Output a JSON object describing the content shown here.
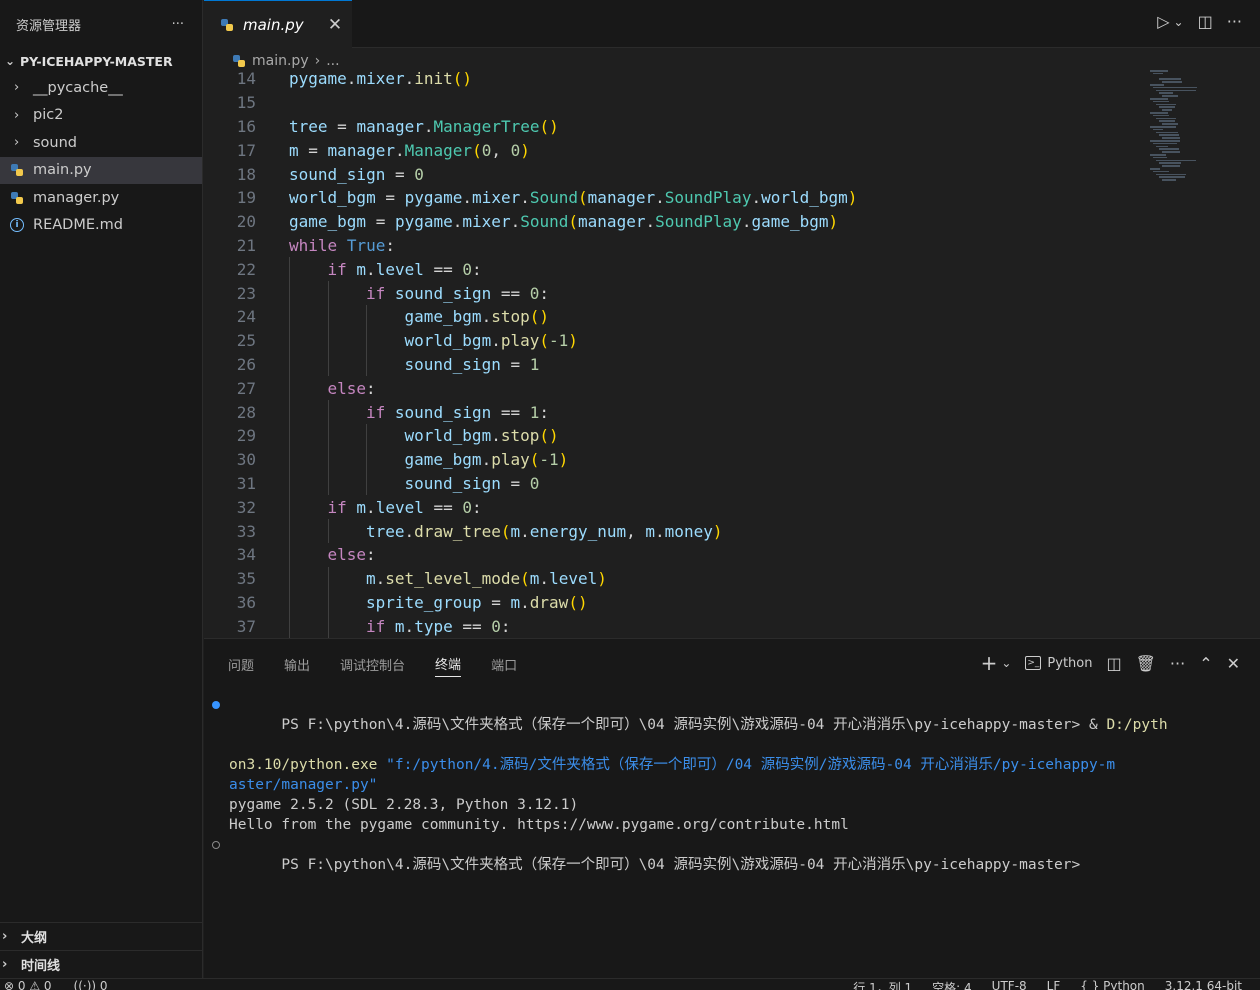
{
  "sidebar": {
    "title": "资源管理器",
    "more": "···",
    "folder": "PY-ICEHAPPY-MASTER",
    "folders": [
      "__pycache__",
      "pic2",
      "sound"
    ],
    "files": [
      "main.py",
      "manager.py",
      "README.md"
    ],
    "outline": "大纲",
    "timeline": "时间线"
  },
  "tab": {
    "label": "main.py",
    "close": "✕"
  },
  "breadcrumb": {
    "file": "main.py",
    "rest": "..."
  },
  "code_lines": [
    {
      "n": "14",
      "html": "<span class=\"v\">pygame</span>.<span class=\"v\">mixer</span>.<span class=\"fn\">init</span><span class=\"p1\">()</span>",
      "indent": 0
    },
    {
      "n": "15",
      "html": "",
      "indent": 0
    },
    {
      "n": "16",
      "html": "<span class=\"v\">tree</span> = <span class=\"v\">manager</span>.<span class=\"cls\">ManagerTree</span><span class=\"p1\">()</span>",
      "indent": 0
    },
    {
      "n": "17",
      "html": "<span class=\"v\">m</span> = <span class=\"v\">manager</span>.<span class=\"cls\">Manager</span><span class=\"p1\">(</span><span class=\"num\">0</span>, <span class=\"num\">0</span><span class=\"p1\">)</span>",
      "indent": 0
    },
    {
      "n": "18",
      "html": "<span class=\"v\">sound_sign</span> = <span class=\"num\">0</span>",
      "indent": 0
    },
    {
      "n": "19",
      "html": "<span class=\"v\">world_bgm</span> = <span class=\"v\">pygame</span>.<span class=\"v\">mixer</span>.<span class=\"cls\">Sound</span><span class=\"p1\">(</span><span class=\"v\">manager</span>.<span class=\"cls\">SoundPlay</span>.<span class=\"v\">world_bgm</span><span class=\"p1\">)</span>",
      "indent": 0
    },
    {
      "n": "20",
      "html": "<span class=\"v\">game_bgm</span> = <span class=\"v\">pygame</span>.<span class=\"v\">mixer</span>.<span class=\"cls\">Sound</span><span class=\"p1\">(</span><span class=\"v\">manager</span>.<span class=\"cls\">SoundPlay</span>.<span class=\"v\">game_bgm</span><span class=\"p1\">)</span>",
      "indent": 0
    },
    {
      "n": "21",
      "html": "<span class=\"kw\">while</span> <span class=\"bl\">True</span>:",
      "indent": 0
    },
    {
      "n": "22",
      "html": "<span class=\"kw\">if</span> <span class=\"v\">m</span>.<span class=\"v\">level</span> == <span class=\"num\">0</span>:",
      "indent": 1
    },
    {
      "n": "23",
      "html": "<span class=\"kw\">if</span> <span class=\"v\">sound_sign</span> == <span class=\"num\">0</span>:",
      "indent": 2
    },
    {
      "n": "24",
      "html": "<span class=\"v\">game_bgm</span>.<span class=\"fn\">stop</span><span class=\"p1\">()</span>",
      "indent": 3
    },
    {
      "n": "25",
      "html": "<span class=\"v\">world_bgm</span>.<span class=\"fn\">play</span><span class=\"p1\">(</span><span class=\"num\">-1</span><span class=\"p1\">)</span>",
      "indent": 3
    },
    {
      "n": "26",
      "html": "<span class=\"v\">sound_sign</span> = <span class=\"num\">1</span>",
      "indent": 3
    },
    {
      "n": "27",
      "html": "<span class=\"kw\">else</span>:",
      "indent": 1
    },
    {
      "n": "28",
      "html": "<span class=\"kw\">if</span> <span class=\"v\">sound_sign</span> == <span class=\"num\">1</span>:",
      "indent": 2
    },
    {
      "n": "29",
      "html": "<span class=\"v\">world_bgm</span>.<span class=\"fn\">stop</span><span class=\"p1\">()</span>",
      "indent": 3
    },
    {
      "n": "30",
      "html": "<span class=\"v\">game_bgm</span>.<span class=\"fn\">play</span><span class=\"p1\">(</span><span class=\"num\">-1</span><span class=\"p1\">)</span>",
      "indent": 3
    },
    {
      "n": "31",
      "html": "<span class=\"v\">sound_sign</span> = <span class=\"num\">0</span>",
      "indent": 3
    },
    {
      "n": "32",
      "html": "<span class=\"kw\">if</span> <span class=\"v\">m</span>.<span class=\"v\">level</span> == <span class=\"num\">0</span>:",
      "indent": 1
    },
    {
      "n": "33",
      "html": "<span class=\"v\">tree</span>.<span class=\"fn\">draw_tree</span><span class=\"p1\">(</span><span class=\"v\">m</span>.<span class=\"v\">energy_num</span>, <span class=\"v\">m</span>.<span class=\"v\">money</span><span class=\"p1\">)</span>",
      "indent": 2
    },
    {
      "n": "34",
      "html": "<span class=\"kw\">else</span>:",
      "indent": 1
    },
    {
      "n": "35",
      "html": "<span class=\"v\">m</span>.<span class=\"fn\">set_level_mode</span><span class=\"p1\">(</span><span class=\"v\">m</span>.<span class=\"v\">level</span><span class=\"p1\">)</span>",
      "indent": 2
    },
    {
      "n": "36",
      "html": "<span class=\"v\">sprite_group</span> = <span class=\"v\">m</span>.<span class=\"fn\">draw</span><span class=\"p1\">()</span>",
      "indent": 2
    },
    {
      "n": "37",
      "html": "<span class=\"kw\">if</span> <span class=\"v\">m</span>.<span class=\"v\">type</span> == <span class=\"num\">0</span>:",
      "indent": 2
    }
  ],
  "panel": {
    "tabs": [
      "问题",
      "输出",
      "调试控制台",
      "终端",
      "端口"
    ],
    "active_tab": "终端",
    "shell": "Python"
  },
  "terminal": {
    "line1_prompt": "PS F:\\python\\4.源码\\文件夹格式（保存一个即可）\\04 源码实例\\游戏源码-04 开心消消乐\\py-icehappy-master> ",
    "line1_amp": "& ",
    "line1_exe": "D:/pyth",
    "line2_exe": "on3.10/python.exe",
    "line2_str": " \"f:/python/4.源码/文件夹格式（保存一个即可）/04 源码实例/游戏源码-04 开心消消乐/py-icehappy-m",
    "line3_str": "aster/manager.py\"",
    "line4": "pygame 2.5.2 (SDL 2.28.3, Python 3.12.1)",
    "line5": "Hello from the pygame community. https://www.pygame.org/contribute.html",
    "line6": "PS F:\\python\\4.源码\\文件夹格式（保存一个即可）\\04 源码实例\\游戏源码-04 开心消消乐\\py-icehappy-master>"
  },
  "statusbar": {
    "errors": "⊗ 0 ⚠ 0",
    "ports": "((·)) 0",
    "position": "行 1，列 1",
    "spaces": "空格: 4",
    "encoding": "UTF-8",
    "eol": "LF",
    "language": "{ } Python",
    "interpreter": "3.12.1 64-bit"
  }
}
